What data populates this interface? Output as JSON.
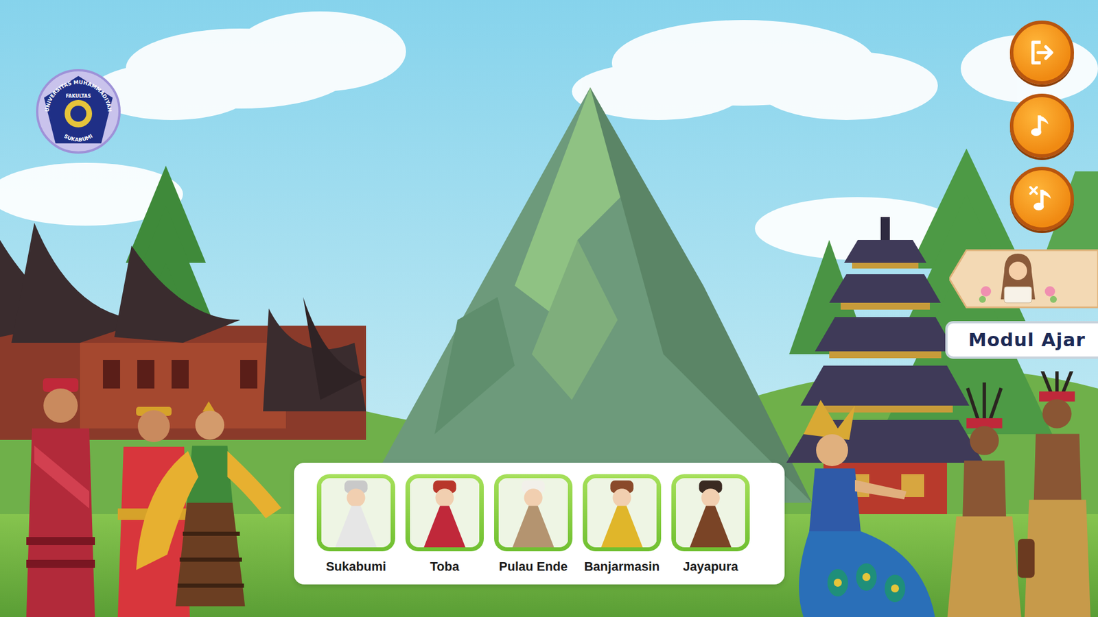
{
  "logo": {
    "top_text": "UNIVERSITAS MUHAMMADIYAH",
    "center_text": "FAKULTAS",
    "bottom_text": "SUKABUMI"
  },
  "controls": [
    {
      "kind": "exit"
    },
    {
      "kind": "music-on"
    },
    {
      "kind": "music-off"
    }
  ],
  "module": {
    "label": "Modul Ajar"
  },
  "regions": [
    {
      "label": "Sukabumi"
    },
    {
      "label": "Toba"
    },
    {
      "label": "Pulau Ende"
    },
    {
      "label": "Banjarmasin"
    },
    {
      "label": "Jayapura"
    }
  ]
}
